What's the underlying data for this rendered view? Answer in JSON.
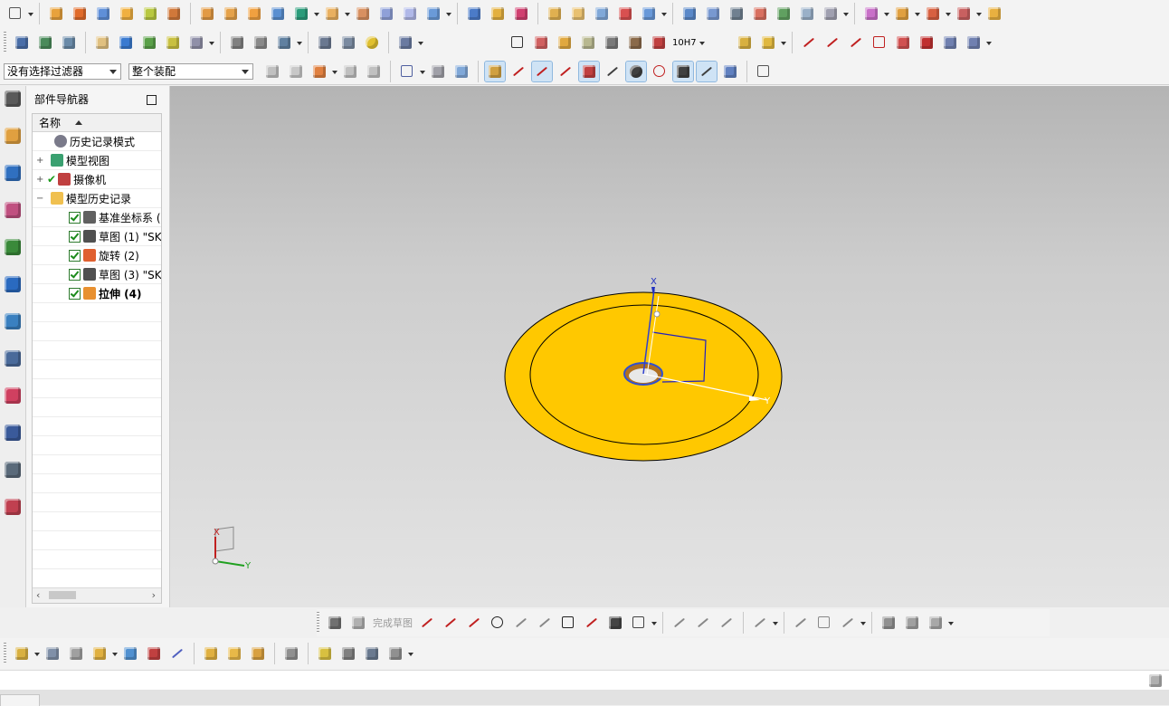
{
  "filters": {
    "selection_filter": "没有选择过滤器",
    "scope": "整个装配"
  },
  "navigator": {
    "title": "部件导航器",
    "column_name": "名称",
    "items": [
      {
        "label": "历史记录模式"
      },
      {
        "label": "模型视图"
      },
      {
        "label": "摄像机"
      },
      {
        "label": "模型历史记录"
      },
      {
        "label": "基准坐标系 ("
      },
      {
        "label": "草图 (1) \"SK"
      },
      {
        "label": "旋转 (2)"
      },
      {
        "label": "草图 (3) \"SK"
      },
      {
        "label": "拉伸 (4)"
      }
    ]
  },
  "viewport": {
    "part_color": "#ffc800",
    "background_top": "#b4b4b4",
    "background_bottom": "#e4e4e4",
    "axis_x_label": "X",
    "axis_y_label": "Y",
    "triad_x_label": "X",
    "triad_y_label": "Y"
  },
  "sketch_toolbar": {
    "finish_sketch_label": "完成草图"
  },
  "toolbar_groups": {
    "row3_dimension_label": "10H7"
  }
}
